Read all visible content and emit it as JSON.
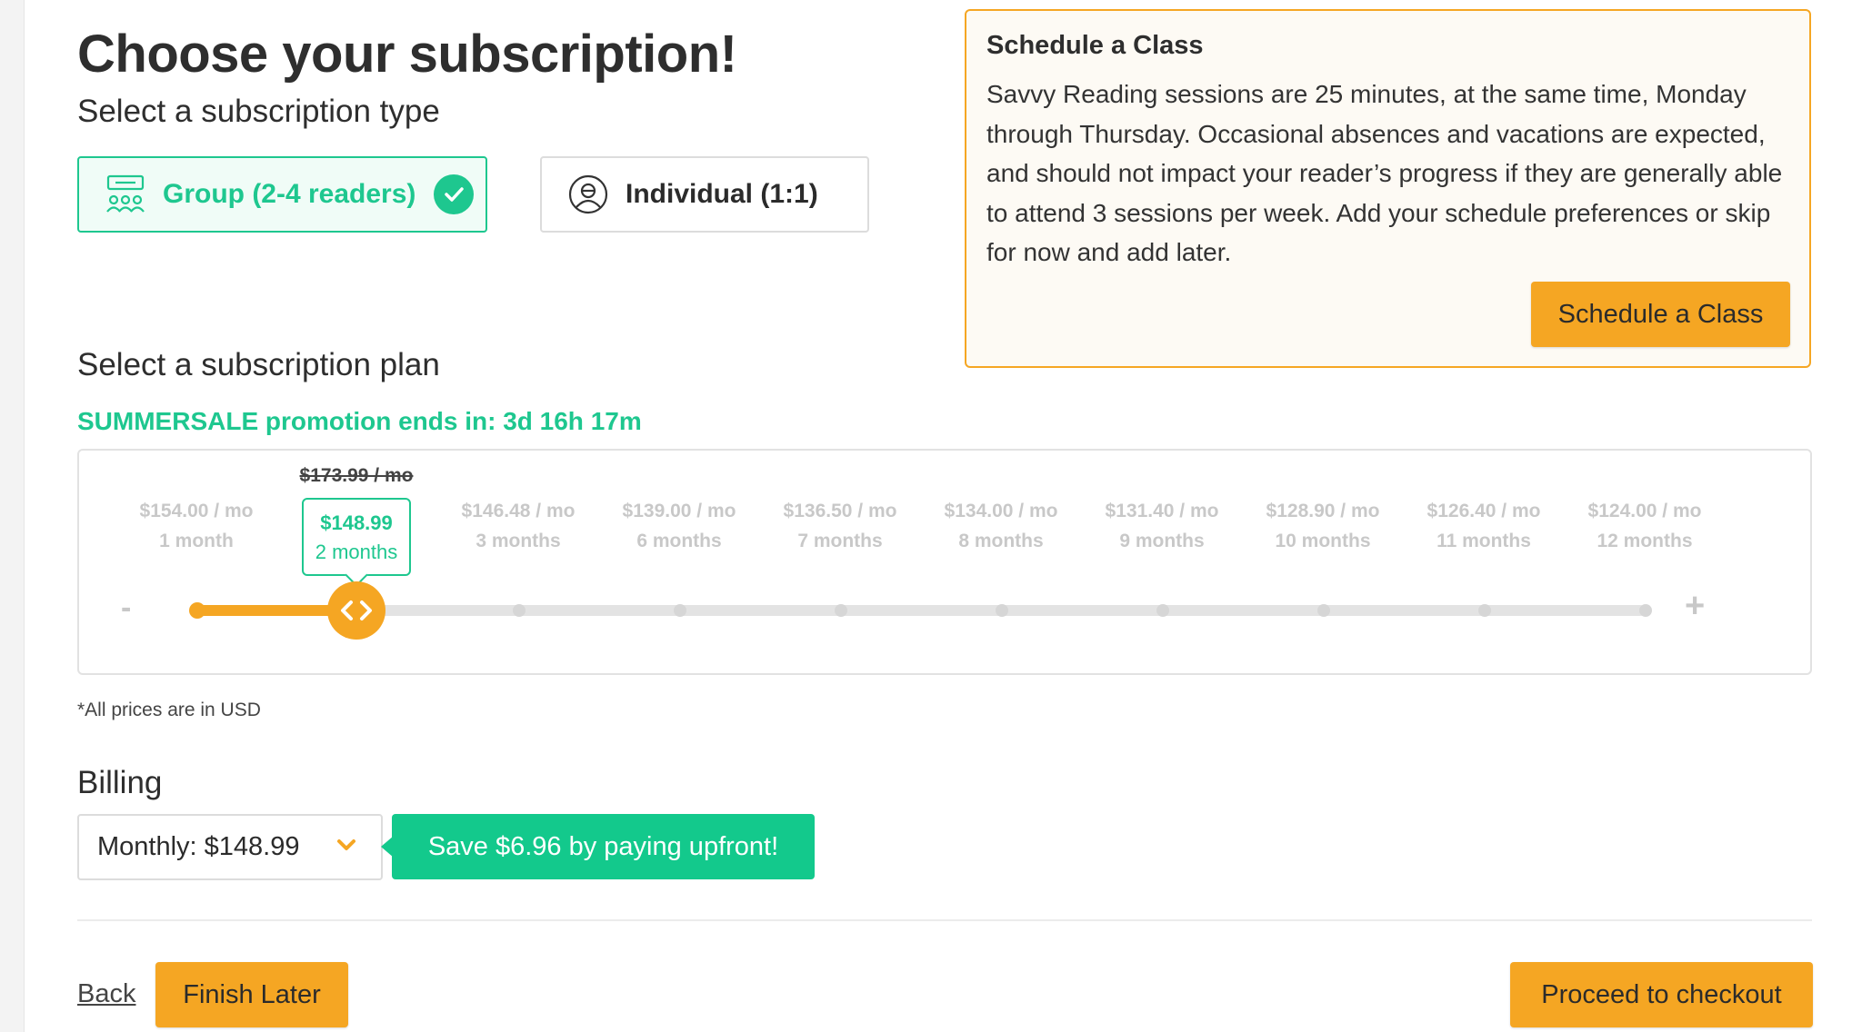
{
  "page": {
    "title": "Choose your subscription!"
  },
  "subscription_type": {
    "heading": "Select a subscription type",
    "options": [
      {
        "label": "Group (2-4 readers)",
        "icon": "group-readers-icon",
        "selected": true
      },
      {
        "label": "Individual (1:1)",
        "icon": "individual-reader-icon",
        "selected": false
      }
    ]
  },
  "schedule": {
    "title": "Schedule a Class",
    "body": "Savvy Reading sessions are 25 minutes, at the same time, Monday through Thursday. Occasional absences and vacations are expected, and should not impact your reader’s progress if they are generally able to attend 3 sessions per week. Add your schedule preferences or skip for now and add later.",
    "button": "Schedule a Class"
  },
  "plan": {
    "heading": "Select a subscription plan",
    "promo": "SUMMERSALE promotion ends in: 3d 16h 17m",
    "minus_label": "-",
    "plus_label": "+",
    "original_price": "$173.99 / mo",
    "selected_index": 1,
    "selected": {
      "price": "$148.99",
      "duration": "2 months"
    },
    "ticks": [
      {
        "price": "$154.00 / mo",
        "duration": "1 month"
      },
      {
        "price": "",
        "duration": ""
      },
      {
        "price": "$146.48 / mo",
        "duration": "3 months"
      },
      {
        "price": "$139.00 / mo",
        "duration": "6 months"
      },
      {
        "price": "$136.50 / mo",
        "duration": "7 months"
      },
      {
        "price": "$134.00 / mo",
        "duration": "8 months"
      },
      {
        "price": "$131.40 / mo",
        "duration": "9 months"
      },
      {
        "price": "$128.90 / mo",
        "duration": "10 months"
      },
      {
        "price": "$126.40 / mo",
        "duration": "11 months"
      },
      {
        "price": "$124.00 / mo",
        "duration": "12 months"
      }
    ],
    "note": "*All prices are in USD"
  },
  "billing": {
    "heading": "Billing",
    "selected": "Monthly: $148.99",
    "save_message": "Save $6.96 by paying upfront!"
  },
  "footer": {
    "back": "Back",
    "finish_later": "Finish Later",
    "checkout": "Proceed to checkout"
  },
  "colors": {
    "accent_orange": "#f5a623",
    "accent_green": "#1ec78f",
    "muted": "#c8c8c8"
  }
}
